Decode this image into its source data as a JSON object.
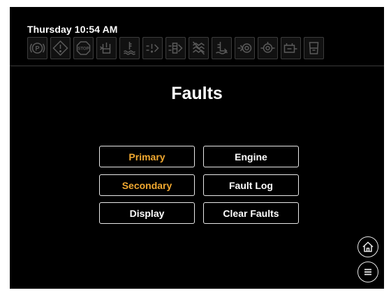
{
  "status_bar": {
    "datetime": "Thursday 10:54 AM",
    "indicator_icons": [
      "parking-brake-icon",
      "warning-icon",
      "stop-icon",
      "coolant-level-icon",
      "coolant-temperature-icon",
      "air-filter-icon",
      "air-filter-restriction-icon",
      "regen-inhibit-icon",
      "fuel-water-separator-icon",
      "dpf-icon",
      "oil-pressure-icon",
      "battery-charging-icon",
      "fuel-level-icon"
    ]
  },
  "page": {
    "title": "Faults"
  },
  "menu": {
    "primary": "Primary",
    "secondary": "Secondary",
    "display": "Display",
    "engine": "Engine",
    "fault_log": "Fault Log",
    "clear_faults": "Clear Faults"
  },
  "colors": {
    "background": "#000000",
    "text": "#ffffff",
    "highlight": "#f0a830",
    "indicator_inactive": "#5a5a5a"
  }
}
